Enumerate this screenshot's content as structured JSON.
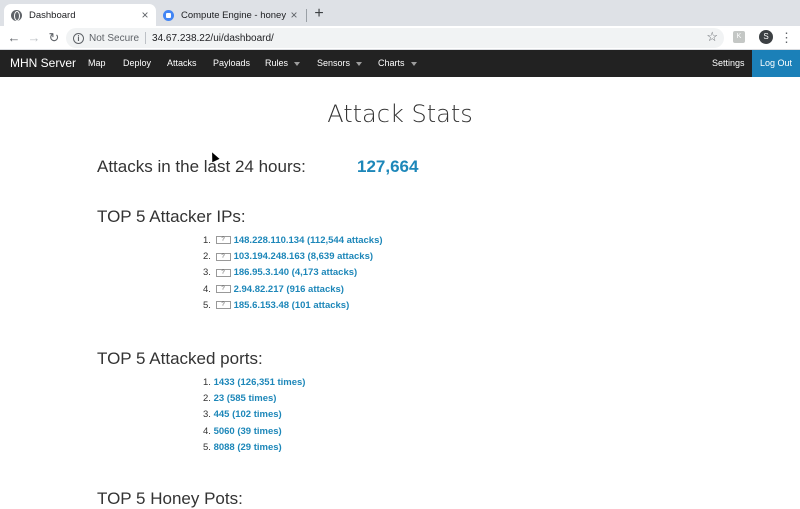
{
  "browser": {
    "tabs": [
      {
        "title": "Dashboard",
        "icon": "globe-icon",
        "active": true
      },
      {
        "title": "Compute Engine - honeypotgo",
        "icon": "compute-engine-icon",
        "active": false
      }
    ],
    "close_glyph": "×",
    "new_tab_glyph": "+",
    "security_label": "Not Secure",
    "url": "34.67.238.22/ui/dashboard/",
    "profile_initial": "S",
    "extension_glyph": "K"
  },
  "navbar": {
    "brand": "MHN Server",
    "items": [
      {
        "label": "Map",
        "dropdown": false
      },
      {
        "label": "Deploy",
        "dropdown": false
      },
      {
        "label": "Attacks",
        "dropdown": false
      },
      {
        "label": "Payloads",
        "dropdown": false
      },
      {
        "label": "Rules",
        "dropdown": true
      },
      {
        "label": "Sensors",
        "dropdown": true
      },
      {
        "label": "Charts",
        "dropdown": true
      }
    ],
    "settings": "Settings",
    "logout": "Log Out",
    "accent_color": "#1b80b8"
  },
  "main": {
    "title": "Attack Stats",
    "attacks_24h_label": "Attacks in the last 24 hours:",
    "attacks_24h_count": "127,664",
    "top_ips": {
      "heading": "TOP 5 Attacker IPs:",
      "items": [
        {
          "num": "1.",
          "flag": "?",
          "text": "148.228.110.134 (112,544 attacks)"
        },
        {
          "num": "2.",
          "flag": "?",
          "text": "103.194.248.163 (8,639 attacks)"
        },
        {
          "num": "3.",
          "flag": "?",
          "text": "186.95.3.140 (4,173 attacks)"
        },
        {
          "num": "4.",
          "flag": "?",
          "text": "2.94.82.217 (916 attacks)"
        },
        {
          "num": "5.",
          "flag": "?",
          "text": "185.6.153.48 (101 attacks)"
        }
      ]
    },
    "top_ports": {
      "heading": "TOP 5 Attacked ports:",
      "items": [
        {
          "num": "1.",
          "text": "1433 (126,351 times)"
        },
        {
          "num": "2.",
          "text": "23 (585 times)"
        },
        {
          "num": "3.",
          "text": "445 (102 times)"
        },
        {
          "num": "4.",
          "text": "5060 (39 times)"
        },
        {
          "num": "5.",
          "text": "8088 (29 times)"
        }
      ]
    },
    "top_honeypots": {
      "heading": "TOP 5 Honey Pots:"
    },
    "link_color": "#1d87b9"
  }
}
